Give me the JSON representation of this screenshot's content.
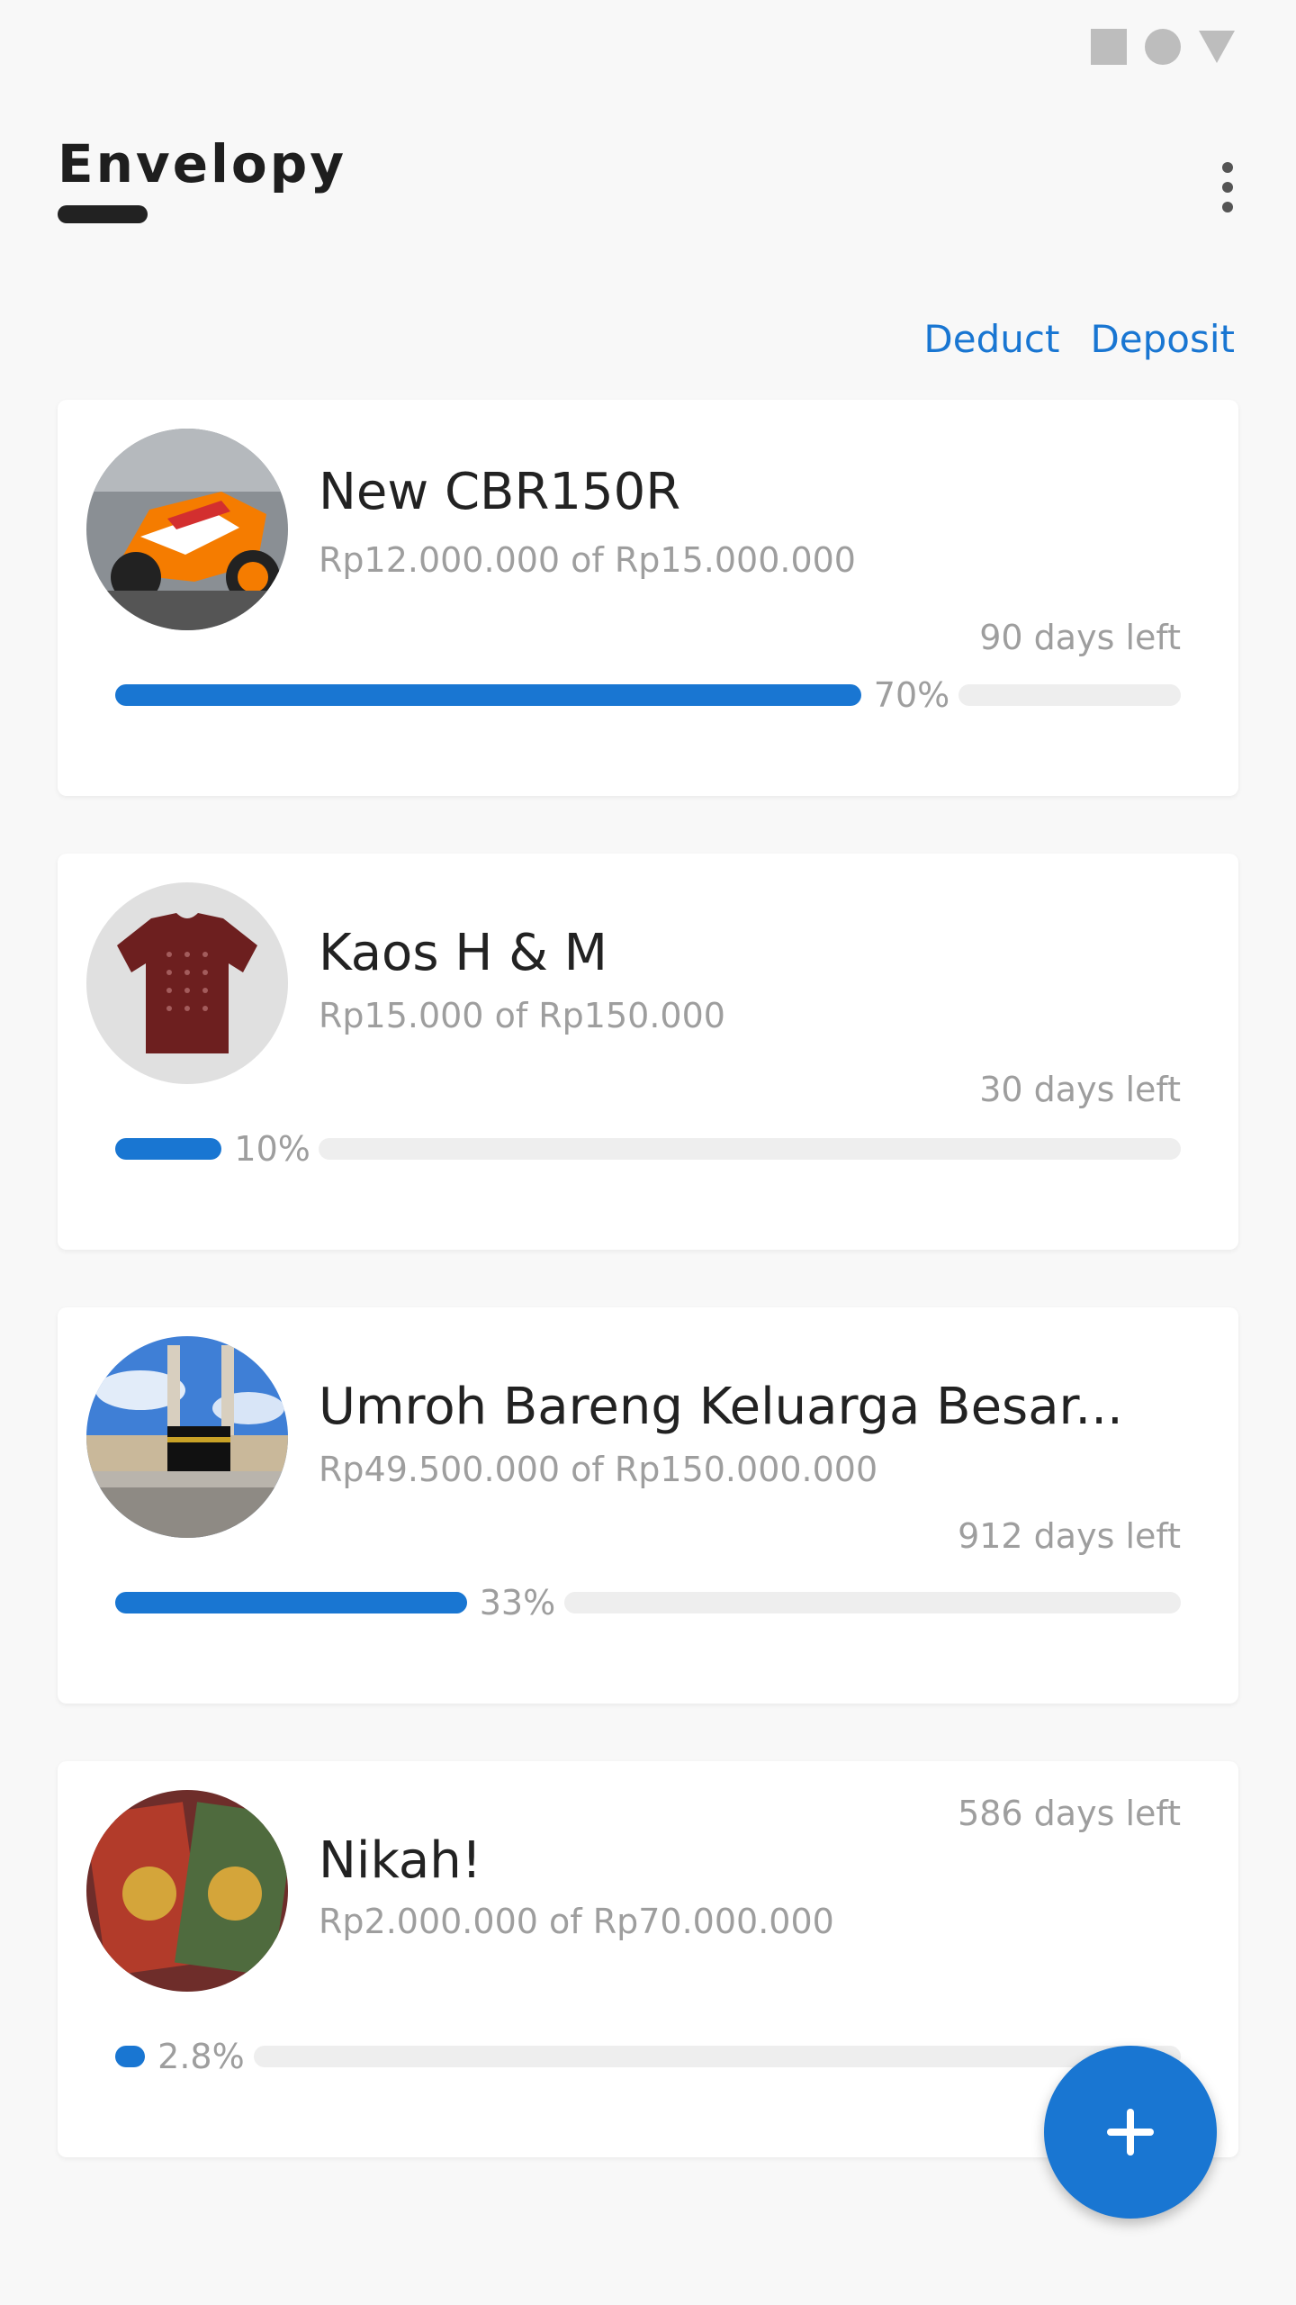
{
  "app": {
    "title": "Envelopy"
  },
  "actions": {
    "deduct": "Deduct",
    "deposit": "Deposit"
  },
  "goals": [
    {
      "name": "New CBR150R",
      "amount": "Rp12.000.000 of Rp15.000.000",
      "days_left": "90 days left",
      "progress": 0.7,
      "progress_label": "70%",
      "image": "motorcycle-image"
    },
    {
      "name": "Kaos H & M",
      "amount": "Rp15.000 of Rp150.000",
      "days_left": "30 days left",
      "progress": 0.1,
      "progress_label": "10%",
      "image": "t-shirt-image"
    },
    {
      "name": "Umroh Bareng Keluarga Besar...",
      "amount": "Rp49.500.000 of Rp150.000.000",
      "days_left": "912 days left",
      "progress": 0.33,
      "progress_label": "33%",
      "image": "kaaba-mosque-image"
    },
    {
      "name": "Nikah!",
      "amount": "Rp2.000.000 of Rp70.000.000",
      "days_left": "586 days left",
      "progress": 0.028,
      "progress_label": "2.8%",
      "image": "marriage-books-image"
    }
  ],
  "colors": {
    "accent": "#1976d2",
    "track": "#eeeeee",
    "muted_text": "#9e9e9e",
    "background": "#f8f8f8"
  },
  "icons": {
    "menu": "more-vert-icon",
    "fab": "plus-icon"
  }
}
